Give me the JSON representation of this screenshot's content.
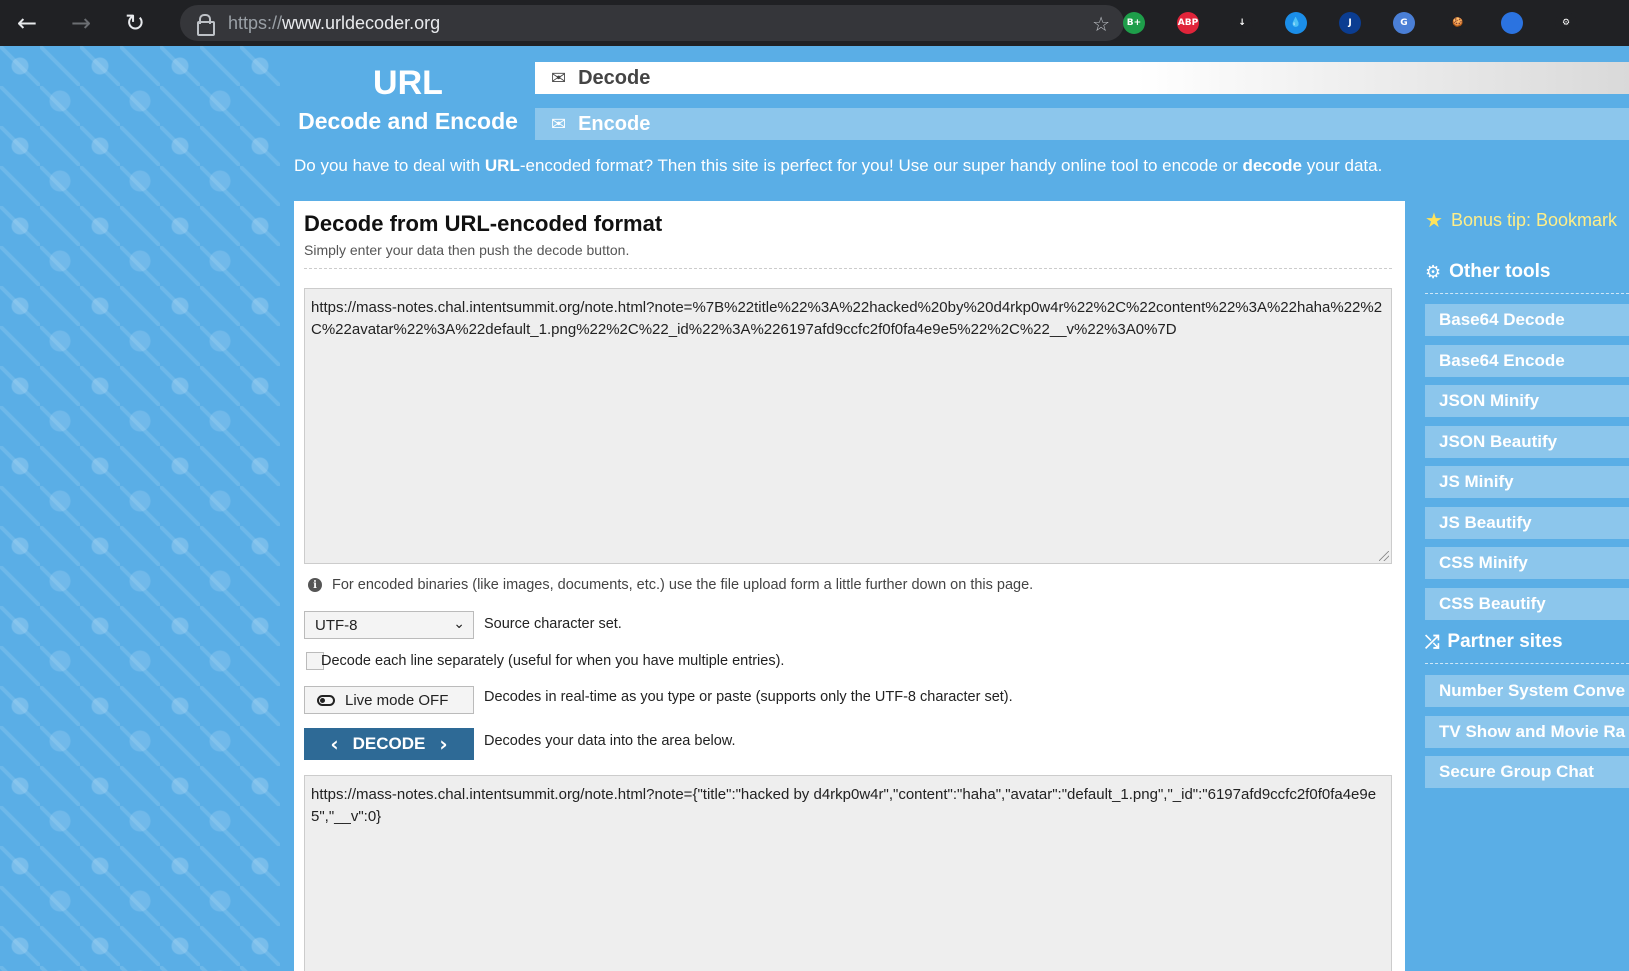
{
  "browser": {
    "url_scheme": "https://",
    "url_host": "www.urldecoder.org",
    "extensions": [
      {
        "name": "bplus-extension-icon",
        "label": "B+",
        "color": "#1e9e4a"
      },
      {
        "name": "adblock-plus-icon",
        "label": "ABP",
        "color": "#e0243a"
      },
      {
        "name": "download-arrow-icon",
        "label": "↓",
        "color": "#202124"
      },
      {
        "name": "raindrop-icon",
        "label": "💧",
        "color": "#1b8ee8"
      },
      {
        "name": "j-extension-icon",
        "label": "J",
        "color": "#0b3d91"
      },
      {
        "name": "google-translate-icon",
        "label": "G",
        "color": "#4a7fd6"
      },
      {
        "name": "cookie-icon",
        "label": "🍪",
        "color": "#202124"
      },
      {
        "name": "globe-extension-icon",
        "label": "",
        "color": "#2b73e0"
      },
      {
        "name": "puzzle-extensions-icon",
        "label": "⚙",
        "color": "#202124"
      }
    ]
  },
  "header": {
    "logo_title": "URL",
    "logo_subtitle": "Decode and Encode",
    "tabs": {
      "decode": "Decode",
      "encode": "Encode"
    },
    "intro_1": "Do you have to deal with ",
    "intro_b1": "URL",
    "intro_2": "-encoded format? Then this site is perfect for you! Use our super handy online tool to encode or ",
    "intro_b2": "decode",
    "intro_3": " your data."
  },
  "main": {
    "title": "Decode from URL-encoded format",
    "subtitle": "Simply enter your data then push the decode button.",
    "input_value": "https://mass-notes.chal.intentsummit.org/note.html?note=%7B%22title%22%3A%22hacked%20by%20d4rkp0w4r%22%2C%22content%22%3A%22haha%22%2C%22avatar%22%3A%22default_1.png%22%2C%22_id%22%3A%226197afd9ccfc2f0f0fa4e9e5%22%2C%22__v%22%3A0%7D",
    "info_text": "For encoded binaries (like images, documents, etc.) use the file upload form a little further down on this page.",
    "charset_value": "UTF-8",
    "charset_label": "Source character set.",
    "line_label": "Decode each line separately (useful for when you have multiple entries).",
    "live_button": "Live mode OFF",
    "live_label": "Decodes in real-time as you type or paste (supports only the UTF-8 character set).",
    "decode_button": "DECODE",
    "decode_label": "Decodes your data into the area below.",
    "output_value": "https://mass-notes.chal.intentsummit.org/note.html?note={\"title\":\"hacked by d4rkp0w4r\",\"content\":\"haha\",\"avatar\":\"default_1.png\",\"_id\":\"6197afd9ccfc2f0f0fa4e9e5\",\"__v\":0}"
  },
  "sidebar": {
    "bonus_tip": "Bonus tip: Bookmark",
    "other_tools_heading": "Other tools",
    "tools": [
      "Base64 Decode",
      "Base64 Encode",
      "JSON Minify",
      "JSON Beautify",
      "JS Minify",
      "JS Beautify",
      "CSS Minify",
      "CSS Beautify"
    ],
    "partner_heading": "Partner sites",
    "partners": [
      "Number System Conve",
      "TV Show and Movie Ra",
      "Secure Group Chat"
    ]
  }
}
